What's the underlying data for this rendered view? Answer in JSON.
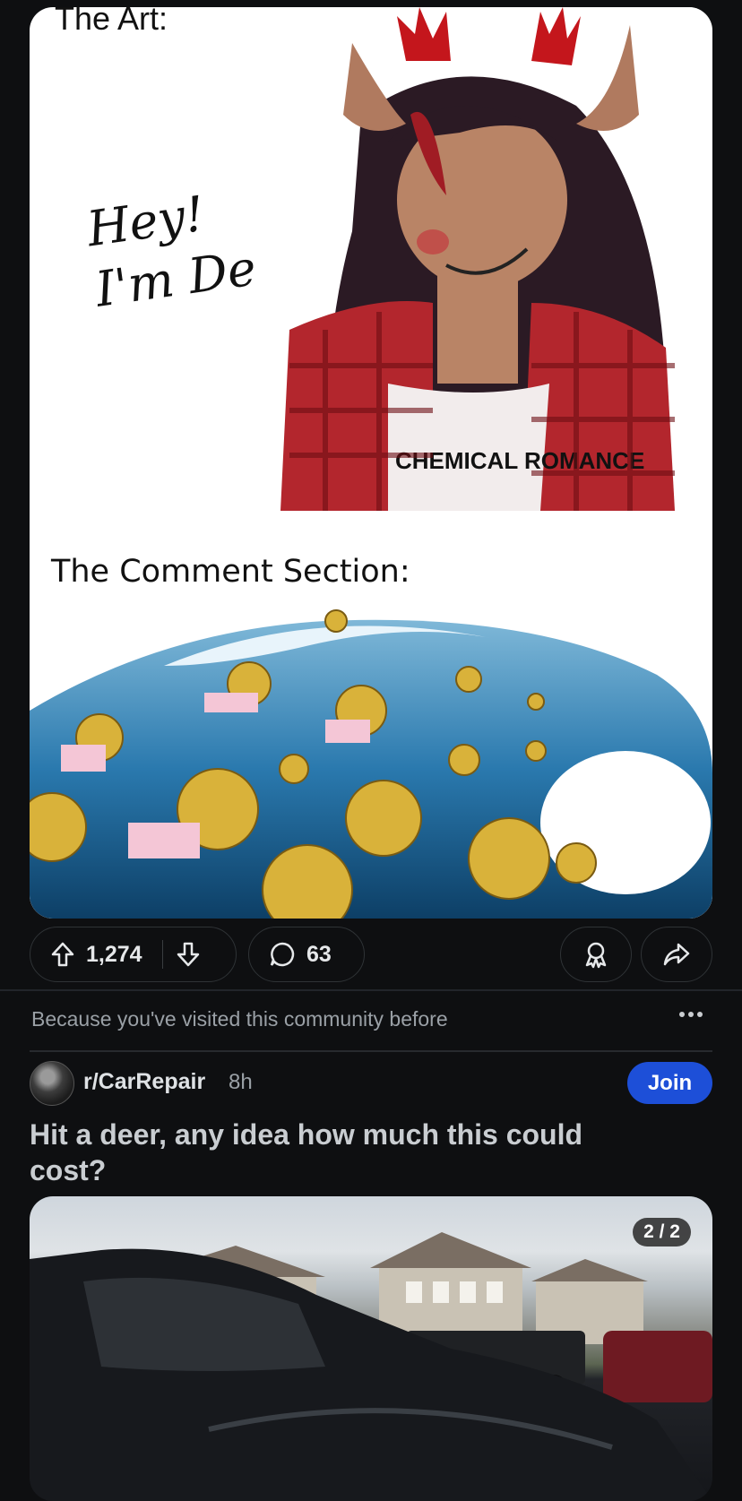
{
  "post1": {
    "meme_top_label": "The Art:",
    "meme_speech": "Hey!\nI'm Dess♡",
    "shirt_text": "CHEMICAL ROMANCE",
    "meme_bottom_label": "The Comment Section:",
    "upvotes": "1,274",
    "comments": "63"
  },
  "feed_reason": "Because you've visited this community before",
  "post2": {
    "subreddit": "r/CarRepair",
    "age": "8h",
    "join_label": "Join",
    "title": "Hit a deer, any idea how much this could cost?",
    "gallery_indicator": "2 / 2"
  },
  "colors": {
    "background": "#0e0f11",
    "join_button": "#1d4fd8",
    "pill_border": "#2f3336"
  }
}
